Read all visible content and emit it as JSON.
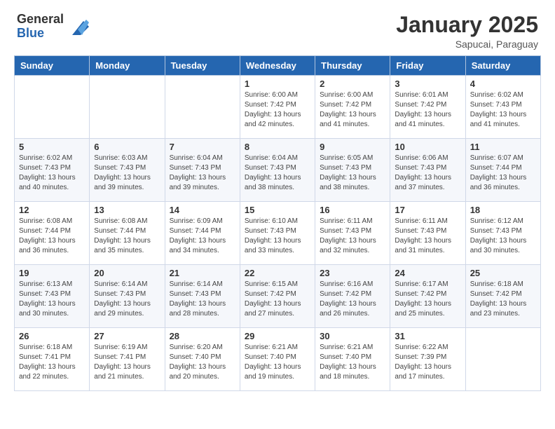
{
  "header": {
    "logo_general": "General",
    "logo_blue": "Blue",
    "month_year": "January 2025",
    "location": "Sapucai, Paraguay"
  },
  "days_of_week": [
    "Sunday",
    "Monday",
    "Tuesday",
    "Wednesday",
    "Thursday",
    "Friday",
    "Saturday"
  ],
  "weeks": [
    [
      {
        "day": "",
        "info": ""
      },
      {
        "day": "",
        "info": ""
      },
      {
        "day": "",
        "info": ""
      },
      {
        "day": "1",
        "info": "Sunrise: 6:00 AM\nSunset: 7:42 PM\nDaylight: 13 hours\nand 42 minutes."
      },
      {
        "day": "2",
        "info": "Sunrise: 6:00 AM\nSunset: 7:42 PM\nDaylight: 13 hours\nand 41 minutes."
      },
      {
        "day": "3",
        "info": "Sunrise: 6:01 AM\nSunset: 7:42 PM\nDaylight: 13 hours\nand 41 minutes."
      },
      {
        "day": "4",
        "info": "Sunrise: 6:02 AM\nSunset: 7:43 PM\nDaylight: 13 hours\nand 41 minutes."
      }
    ],
    [
      {
        "day": "5",
        "info": "Sunrise: 6:02 AM\nSunset: 7:43 PM\nDaylight: 13 hours\nand 40 minutes."
      },
      {
        "day": "6",
        "info": "Sunrise: 6:03 AM\nSunset: 7:43 PM\nDaylight: 13 hours\nand 39 minutes."
      },
      {
        "day": "7",
        "info": "Sunrise: 6:04 AM\nSunset: 7:43 PM\nDaylight: 13 hours\nand 39 minutes."
      },
      {
        "day": "8",
        "info": "Sunrise: 6:04 AM\nSunset: 7:43 PM\nDaylight: 13 hours\nand 38 minutes."
      },
      {
        "day": "9",
        "info": "Sunrise: 6:05 AM\nSunset: 7:43 PM\nDaylight: 13 hours\nand 38 minutes."
      },
      {
        "day": "10",
        "info": "Sunrise: 6:06 AM\nSunset: 7:43 PM\nDaylight: 13 hours\nand 37 minutes."
      },
      {
        "day": "11",
        "info": "Sunrise: 6:07 AM\nSunset: 7:44 PM\nDaylight: 13 hours\nand 36 minutes."
      }
    ],
    [
      {
        "day": "12",
        "info": "Sunrise: 6:08 AM\nSunset: 7:44 PM\nDaylight: 13 hours\nand 36 minutes."
      },
      {
        "day": "13",
        "info": "Sunrise: 6:08 AM\nSunset: 7:44 PM\nDaylight: 13 hours\nand 35 minutes."
      },
      {
        "day": "14",
        "info": "Sunrise: 6:09 AM\nSunset: 7:44 PM\nDaylight: 13 hours\nand 34 minutes."
      },
      {
        "day": "15",
        "info": "Sunrise: 6:10 AM\nSunset: 7:43 PM\nDaylight: 13 hours\nand 33 minutes."
      },
      {
        "day": "16",
        "info": "Sunrise: 6:11 AM\nSunset: 7:43 PM\nDaylight: 13 hours\nand 32 minutes."
      },
      {
        "day": "17",
        "info": "Sunrise: 6:11 AM\nSunset: 7:43 PM\nDaylight: 13 hours\nand 31 minutes."
      },
      {
        "day": "18",
        "info": "Sunrise: 6:12 AM\nSunset: 7:43 PM\nDaylight: 13 hours\nand 30 minutes."
      }
    ],
    [
      {
        "day": "19",
        "info": "Sunrise: 6:13 AM\nSunset: 7:43 PM\nDaylight: 13 hours\nand 30 minutes."
      },
      {
        "day": "20",
        "info": "Sunrise: 6:14 AM\nSunset: 7:43 PM\nDaylight: 13 hours\nand 29 minutes."
      },
      {
        "day": "21",
        "info": "Sunrise: 6:14 AM\nSunset: 7:43 PM\nDaylight: 13 hours\nand 28 minutes."
      },
      {
        "day": "22",
        "info": "Sunrise: 6:15 AM\nSunset: 7:42 PM\nDaylight: 13 hours\nand 27 minutes."
      },
      {
        "day": "23",
        "info": "Sunrise: 6:16 AM\nSunset: 7:42 PM\nDaylight: 13 hours\nand 26 minutes."
      },
      {
        "day": "24",
        "info": "Sunrise: 6:17 AM\nSunset: 7:42 PM\nDaylight: 13 hours\nand 25 minutes."
      },
      {
        "day": "25",
        "info": "Sunrise: 6:18 AM\nSunset: 7:42 PM\nDaylight: 13 hours\nand 23 minutes."
      }
    ],
    [
      {
        "day": "26",
        "info": "Sunrise: 6:18 AM\nSunset: 7:41 PM\nDaylight: 13 hours\nand 22 minutes."
      },
      {
        "day": "27",
        "info": "Sunrise: 6:19 AM\nSunset: 7:41 PM\nDaylight: 13 hours\nand 21 minutes."
      },
      {
        "day": "28",
        "info": "Sunrise: 6:20 AM\nSunset: 7:40 PM\nDaylight: 13 hours\nand 20 minutes."
      },
      {
        "day": "29",
        "info": "Sunrise: 6:21 AM\nSunset: 7:40 PM\nDaylight: 13 hours\nand 19 minutes."
      },
      {
        "day": "30",
        "info": "Sunrise: 6:21 AM\nSunset: 7:40 PM\nDaylight: 13 hours\nand 18 minutes."
      },
      {
        "day": "31",
        "info": "Sunrise: 6:22 AM\nSunset: 7:39 PM\nDaylight: 13 hours\nand 17 minutes."
      },
      {
        "day": "",
        "info": ""
      }
    ]
  ]
}
